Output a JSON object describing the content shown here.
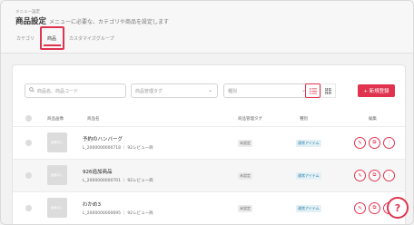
{
  "header": {
    "breadcrumb": "メニュー設定",
    "title": "商品設定",
    "description": "メニューに必要な、カテゴリや商品を設定します"
  },
  "tabs": [
    {
      "label": "カテゴリ"
    },
    {
      "label": "商品"
    },
    {
      "label": "カスタマイズグループ"
    }
  ],
  "filters": {
    "search_placeholder": "商品名、商品コード",
    "tag_placeholder": "商品管理タグ",
    "type_placeholder": "種別"
  },
  "buttons": {
    "new": "+ 新規登録"
  },
  "table": {
    "headers": {
      "image": "商品画像",
      "name": "商品名",
      "tag": "商品管理タグ",
      "type": "種別",
      "edit": "編集"
    },
    "rows": [
      {
        "thumb": "画像なし",
        "name": "予約のハンバーグ",
        "code": "L_2000000000718",
        "reviews": "92レビュー商",
        "tag": "未設定",
        "type": "通常アイテム"
      },
      {
        "thumb": "画像なし",
        "name": "926追加商品",
        "code": "L_2000000000701",
        "reviews": "92レビュー商",
        "tag": "未設定",
        "type": "通常アイテム"
      },
      {
        "thumb": "画像なし",
        "name": "わかめ3",
        "code": "L_2000000000695",
        "reviews": "92レビュー商",
        "tag": "未設定",
        "type": "通常アイテム"
      }
    ]
  },
  "help": {
    "label": "?"
  },
  "colors": {
    "accent": "#e0334f"
  }
}
